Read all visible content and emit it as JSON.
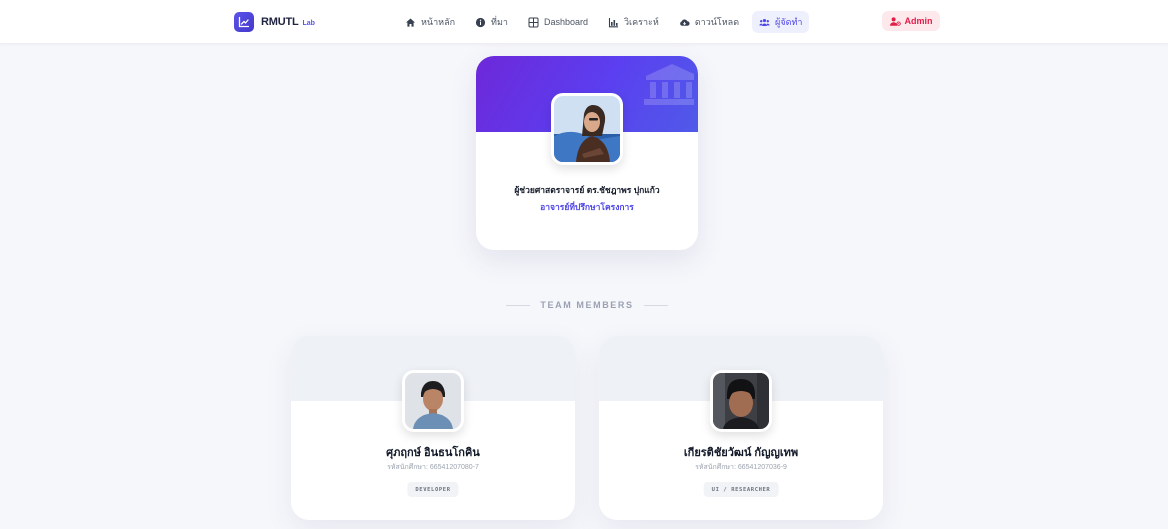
{
  "brand": {
    "name": "RMUTL",
    "suffix": "Lab",
    "accent": "#4f46e5"
  },
  "nav": {
    "items": [
      {
        "label": "หน้าหลัก",
        "icon": "home-icon"
      },
      {
        "label": "ที่มา",
        "icon": "info-icon"
      },
      {
        "label": "Dashboard",
        "icon": "dashboard-grid-icon"
      },
      {
        "label": "วิเคราะห์",
        "icon": "analyze-icon"
      },
      {
        "label": "ดาวน์โหลด",
        "icon": "cloud-download-icon"
      },
      {
        "label": "ผู้จัดทำ",
        "icon": "team-icon",
        "active": true
      }
    ],
    "admin_label": "Admin",
    "admin_color": "#e11d48"
  },
  "advisor": {
    "name": "ผู้ช่วยศาสตราจารย์ ดร.ชัชฎาพร ปุกแก้ว",
    "role": "อาจารย์ที่ปรึกษาโครงการ"
  },
  "team_heading": "TEAM MEMBERS",
  "members": [
    {
      "name": "ศุภฤกษ์ อินธนโกคิน",
      "student_id": "รหัสนักศึกษา: 66541207080-7",
      "role": "DEVELOPER"
    },
    {
      "name": "เกียรติชัยวัฒน์ กัญญเทพ",
      "student_id": "รหัสนักศึกษา: 66541207036-9",
      "role": "UI / RESEARCHER"
    }
  ]
}
